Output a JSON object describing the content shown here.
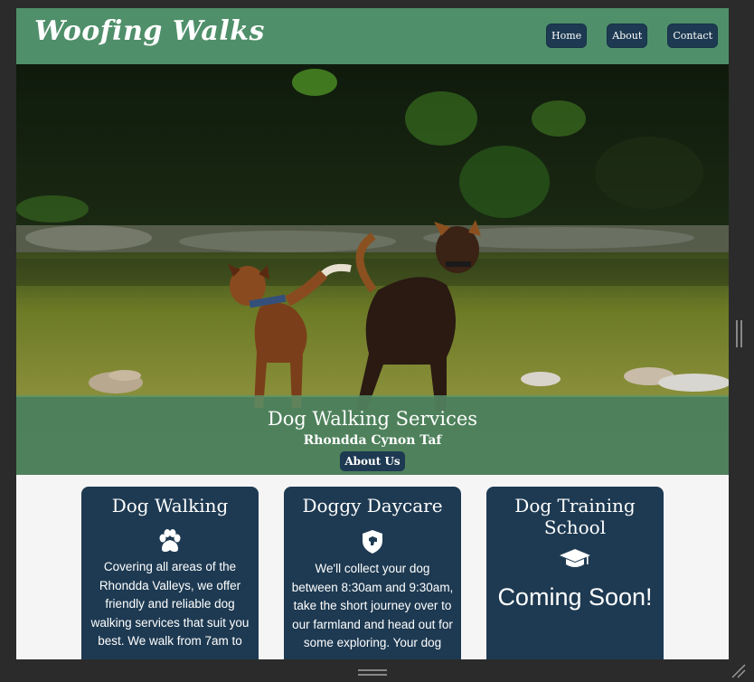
{
  "header": {
    "brand": "Woofing Walks",
    "nav": [
      "Home",
      "About",
      "Contact"
    ]
  },
  "hero": {
    "title": "Dog Walking Services",
    "subtitle": "Rhondda Cynon Taf",
    "button": "About Us"
  },
  "cards": [
    {
      "title": "Dog Walking",
      "icon": "paw-icon",
      "text": "Covering all areas of the Rhondda Valleys, we offer friendly and reliable dog walking services that suit you best. We walk from 7am to"
    },
    {
      "title": "Doggy Daycare",
      "icon": "dog-shield-icon",
      "text": "We'll collect your dog between 8:30am and 9:30am, take the short journey over to our farmland and head out for some exploring. Your dog"
    },
    {
      "title": "Dog Training School",
      "icon": "graduation-cap-icon",
      "coming_soon": "Coming Soon!"
    }
  ],
  "colors": {
    "header": "#4f8f6a",
    "navy": "#1e3a52",
    "band": "#5a966e"
  }
}
